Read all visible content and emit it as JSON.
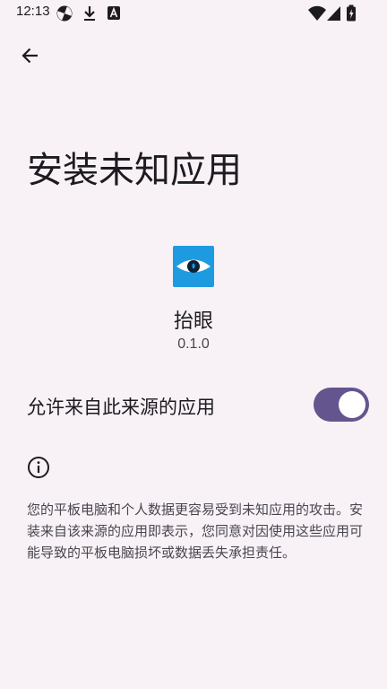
{
  "status_bar": {
    "time": "12:13",
    "icons": [
      "pinwheel-icon",
      "download-icon",
      "a-box-icon",
      "wifi-icon",
      "signal-icon",
      "battery-icon"
    ]
  },
  "header": {
    "back_icon": "arrow-back-icon"
  },
  "page": {
    "title": "安装未知应用"
  },
  "app": {
    "name": "抬眼",
    "version": "0.1.0",
    "icon": "eye-icon",
    "icon_color": "#1e9be0"
  },
  "setting": {
    "label": "允许来自此来源的应用",
    "enabled": true,
    "switch_color": "#65558f"
  },
  "info": {
    "icon": "info-icon",
    "text": "您的平板电脑和个人数据更容易受到未知应用的攻击。安装来自该来源的应用即表示，您同意对因使用这些应用可能导致的平板电脑损坏或数据丢失承担责任。"
  }
}
